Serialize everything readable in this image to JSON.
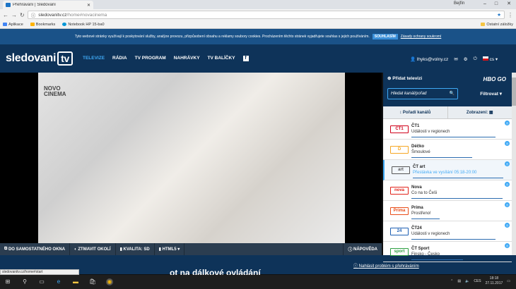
{
  "browser": {
    "tab_title": "Přehrávání | Sledovaní",
    "user": "Bejfín",
    "url_host": "sledovanitv.cz",
    "url_path": "/home#novacinema",
    "bookmarks": [
      "Aplikace",
      "Bookmarks",
      "Notebook HP 15-ba0"
    ],
    "other_bookmarks": "Ostatní záložky"
  },
  "cookie": {
    "text": "Tyto webové stránky využívají k poskytování služby, analýze provozu, přizpůsobení obsahu a reklamy soubory cookies. Procházením těchto stránek vyjadřujete souhlas s jejich používáním.",
    "agree": "SOUHLASÍM",
    "link": "Zásady ochrany soukromí"
  },
  "header": {
    "logo": "sledovani",
    "logo_box": "tv",
    "nav": [
      "TELEVIZE",
      "RÁDIA",
      "TV PROGRAM",
      "NAHRÁVKY",
      "TV BALÍČKY"
    ],
    "user": "lhyks@volny.cz",
    "lang": "cs"
  },
  "player": {
    "channel_logo_top": "NOVO",
    "channel_logo_bottom": "CINEMA",
    "controls": [
      "DO SAMOSTATNÉHO OKNA",
      "ZTMAVIT OKOLÍ",
      "KVALITA: SD",
      "HTML5"
    ],
    "help": "NÁPOVĚDA"
  },
  "below": {
    "title": "ot na dálkové ovládání",
    "report": "Nahlásit problém s přehráváním",
    "status_url": "sledovanitv.cz/home#start"
  },
  "sidebar": {
    "add_channel": "Přidat televizi",
    "hbo": "HBO GO",
    "search_placeholder": "Hledat kanál/pořad",
    "filter": "Filtrovat",
    "sort": "Pořadí kanálů",
    "view": "Zobrazení:",
    "channels": [
      {
        "logo": "ČT1",
        "name": "ČT1",
        "program": "Události v regionech",
        "progress": 0.9,
        "color": "#d0021b"
      },
      {
        "logo": "D",
        "name": "Déčko",
        "program": "Šmoulové",
        "progress": 0.65,
        "color": "#f5a623"
      },
      {
        "logo": "art",
        "name": "ČT art",
        "program": "Přestávka ve vysílání 05:18-20:00",
        "progress": 0.97,
        "color": "#555555"
      },
      {
        "logo": "nova",
        "name": "Nova",
        "program": "Co na to Češi",
        "progress": 0.98,
        "color": "#e2231a"
      },
      {
        "logo": "Prima",
        "name": "Prima",
        "program": "Prostřeno!",
        "progress": 0.3,
        "color": "#e94e1b"
      },
      {
        "logo": "24",
        "name": "ČT24",
        "program": "Události v regionech",
        "progress": 0.9,
        "color": "#1d5fb3"
      },
      {
        "logo": "sport",
        "name": "ČT Sport",
        "program": "Finsko - Česko",
        "progress": 0.55,
        "color": "#2ea043"
      }
    ]
  },
  "taskbar": {
    "lang": "CES",
    "time": "18:18",
    "date": "27.11.2017"
  }
}
